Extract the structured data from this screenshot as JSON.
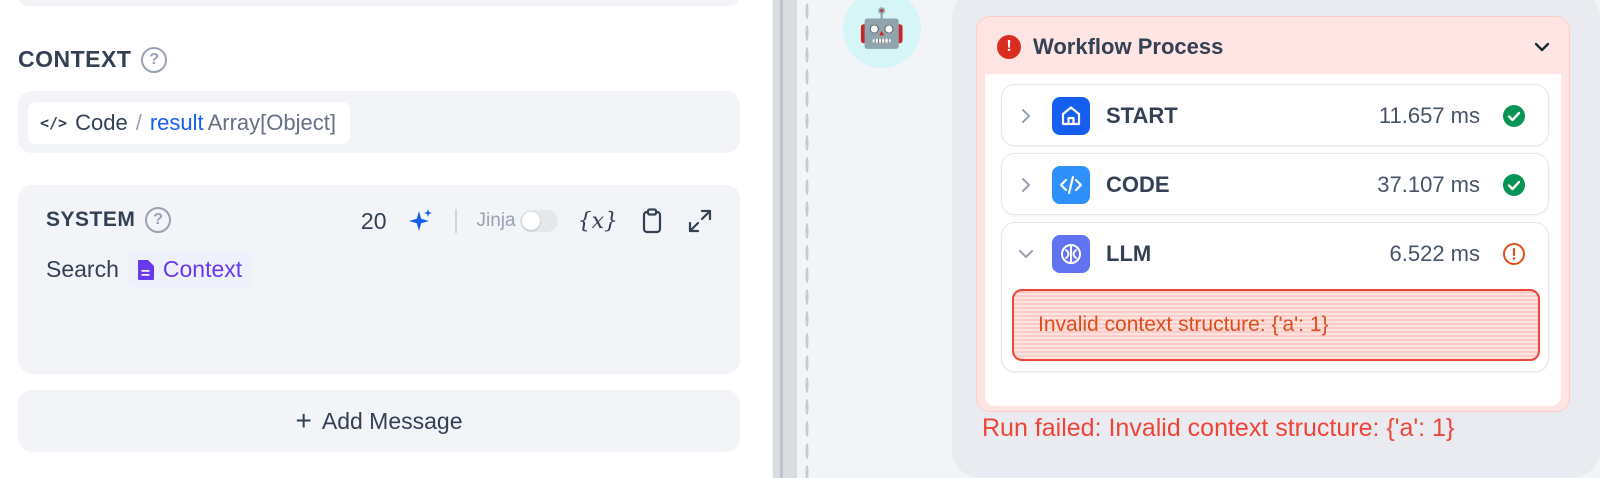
{
  "left": {
    "context": {
      "title": "CONTEXT",
      "help": "?",
      "variable": {
        "node": "Code",
        "separator": "/",
        "name": "result",
        "type": "Array[Object]"
      }
    },
    "system": {
      "title": "SYSTEM",
      "help": "?",
      "count": "20",
      "jinja_label": "Jinja",
      "jinja_enabled": false,
      "var_insert": "{x}",
      "prompt_text": "Search",
      "context_tag": "Context"
    },
    "add_message": "Add Message",
    "add_icon": "+"
  },
  "chat": {
    "avatar": "🤖",
    "workflow": {
      "title": "Workflow Process",
      "status_icon": "!",
      "nodes": [
        {
          "title": "START",
          "time": "11.657 ms",
          "status": "success",
          "icon": "home-icon",
          "expanded": false
        },
        {
          "title": "CODE",
          "time": "37.107 ms",
          "status": "success",
          "icon": "code-icon",
          "expanded": false
        },
        {
          "title": "LLM",
          "time": "6.522 ms",
          "status": "error",
          "icon": "llm-icon",
          "expanded": true,
          "error": "Invalid context structure: {'a': 1}"
        }
      ]
    },
    "run_failed": "Run failed: Invalid context structure: {'a': 1}"
  },
  "colors": {
    "accent": "#155eef",
    "error": "#f04438",
    "success": "#079455",
    "warning": "#e04f16",
    "context_tag": "#6938ef"
  }
}
